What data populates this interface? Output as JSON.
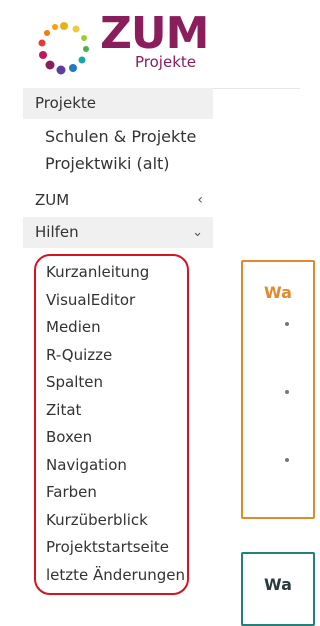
{
  "logo": {
    "name": "ZUM",
    "subtitle": "Projekte"
  },
  "sidebar": {
    "projekte": {
      "label": "Projekte",
      "items": [
        "Schulen & Projekte",
        "Projektwiki (alt)"
      ]
    },
    "zum": {
      "label": "ZUM",
      "icon": "chevron-left-icon"
    },
    "hilfen": {
      "label": "Hilfen",
      "icon": "chevron-down-icon",
      "items": [
        "Kurzanleitung",
        "VisualEditor",
        "Medien",
        "R-Quizze",
        "Spalten",
        "Zitat",
        "Boxen",
        "Navigation",
        "Farben",
        "Kurzüberblick",
        "Projektstartseite",
        "letzte Änderungen"
      ]
    }
  },
  "content": {
    "box1_title": "Wa",
    "box2_title": "Wa"
  },
  "colors": {
    "brand": "#8a1d5c",
    "highlight_outline": "#d8131f",
    "box_orange": "#e08a2c",
    "box_teal": "#26807a",
    "section_bg": "#f0f0f0"
  }
}
